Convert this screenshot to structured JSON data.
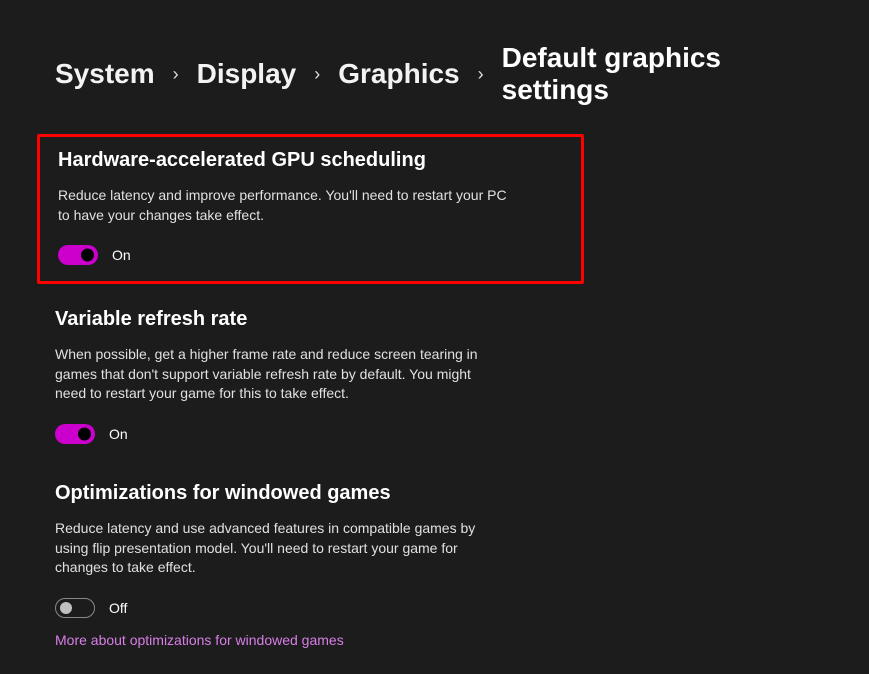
{
  "breadcrumb": {
    "items": [
      {
        "label": "System"
      },
      {
        "label": "Display"
      },
      {
        "label": "Graphics"
      },
      {
        "label": "Default graphics settings"
      }
    ]
  },
  "sections": {
    "gpu": {
      "title": "Hardware-accelerated GPU scheduling",
      "description": "Reduce latency and improve performance. You'll need to restart your PC to have your changes take effect.",
      "toggleState": "On"
    },
    "vrr": {
      "title": "Variable refresh rate",
      "description": "When possible, get a higher frame rate and reduce screen tearing in games that don't support variable refresh rate by default. You might need to restart your game for this to take effect.",
      "toggleState": "On"
    },
    "windowed": {
      "title": "Optimizations for windowed games",
      "description": "Reduce latency and use advanced features in compatible games by using flip presentation model. You'll need to restart your game for changes to take effect.",
      "toggleState": "Off",
      "link": "More about optimizations for windowed games"
    }
  }
}
